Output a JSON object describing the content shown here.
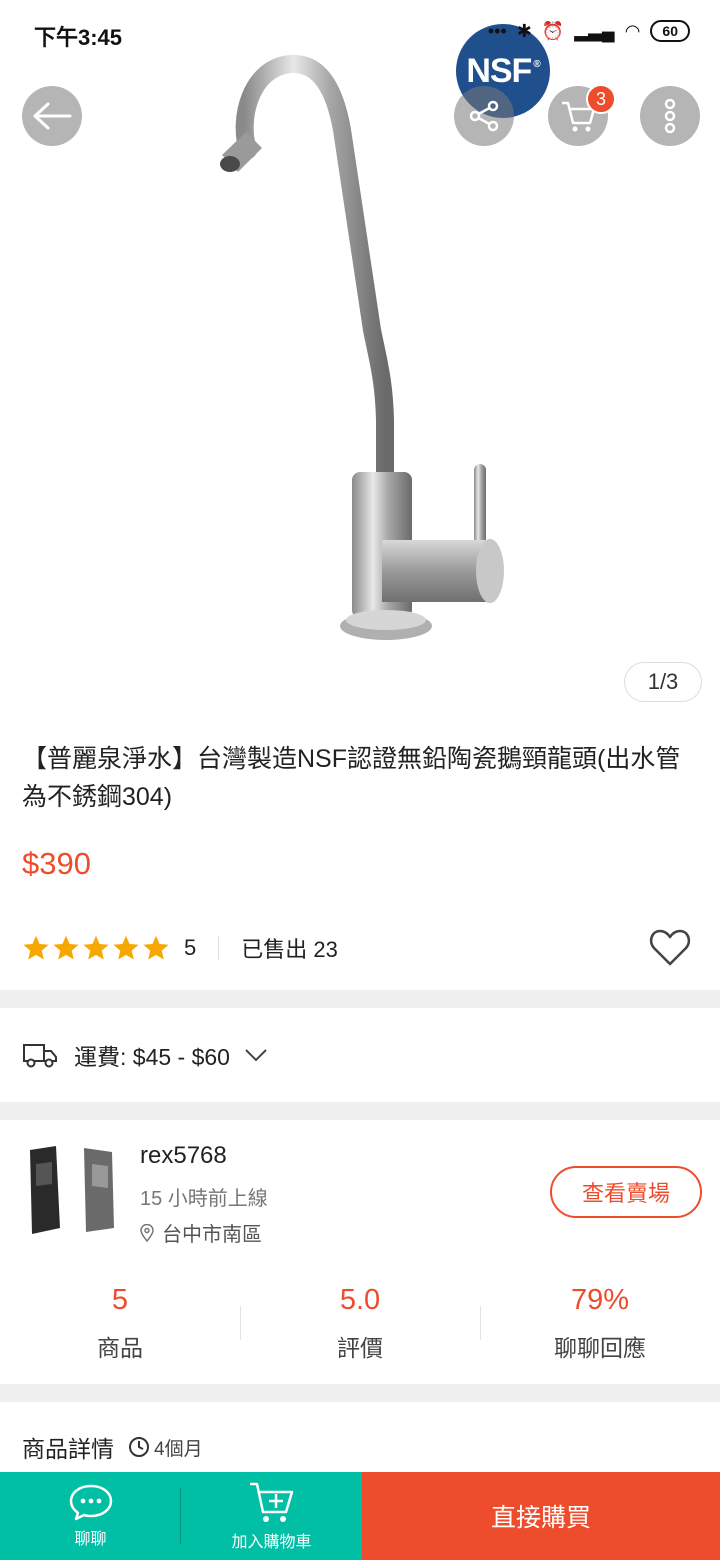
{
  "status_bar": {
    "time": "下午3:45",
    "battery": "60"
  },
  "hero": {
    "logo_text": "NSF",
    "pager": "1/3"
  },
  "header": {
    "cart_count": "3"
  },
  "product": {
    "title": "【普麗泉淨水】台灣製造NSF認證無鉛陶瓷鵝頸龍頭(出水管為不銹鋼304)",
    "price": "$390",
    "rating": "5",
    "stars": 5,
    "sold": "已售出 23"
  },
  "shipping": {
    "label": "運費: $45 - $60"
  },
  "shop": {
    "name": "rex5768",
    "online": "15 小時前上線",
    "location": "台中市南區",
    "view_button": "查看賣場",
    "stats": [
      {
        "value": "5",
        "label": "商品"
      },
      {
        "value": "5.0",
        "label": "評價"
      },
      {
        "value": "79%",
        "label": "聊聊回應"
      }
    ]
  },
  "details": {
    "title": "商品詳情",
    "age": "4個月"
  },
  "bottom_bar": {
    "chat_label": "聊聊",
    "add_cart_label": "加入購物車",
    "buy_now_label": "直接購買"
  },
  "colors": {
    "accent": "#ee4d2d",
    "teal": "#00bfa5",
    "star": "#f6a700"
  }
}
